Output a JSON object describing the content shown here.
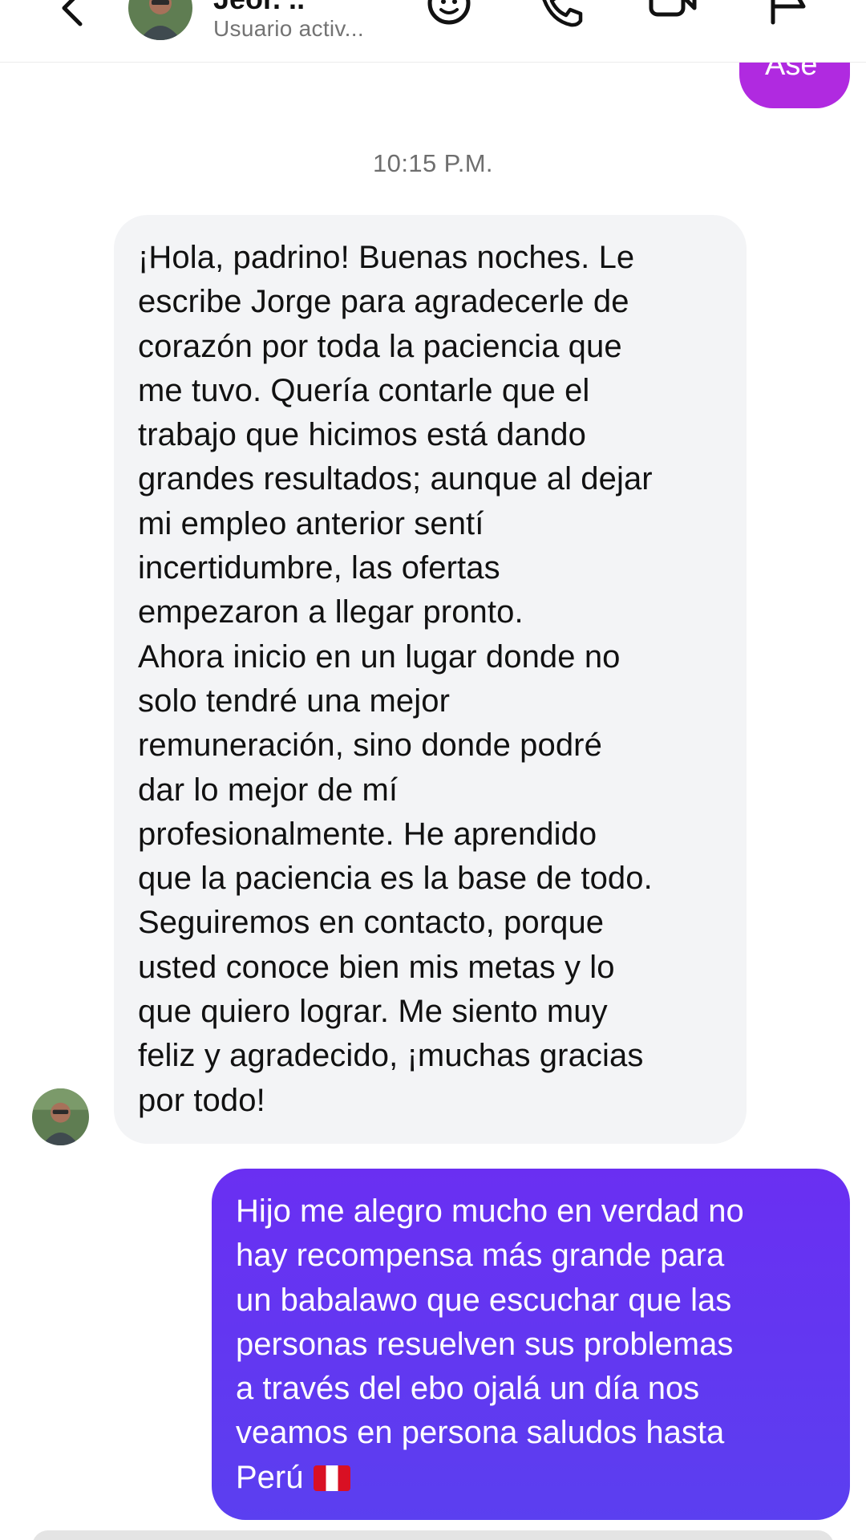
{
  "header": {
    "contact_name": "Jeor. ..",
    "contact_status": "Usuario activ...",
    "icons": [
      "back-arrow",
      "avatar",
      "sticker-face",
      "phone-call",
      "video-call",
      "flag-report"
    ]
  },
  "previous_message": {
    "text": "Ase"
  },
  "timestamp": "10:15 P.M.",
  "incoming_message": {
    "text": "¡Hola, padrino! Buenas noches. Le\nescribe Jorge para agradecerle de\ncorazón por toda la paciencia que\nme tuvo. Quería contarle que el\ntrabajo que hicimos está dando\ngrandes resultados; aunque al dejar\nmi empleo anterior sentí\nincertidumbre, las ofertas\nempezaron a llegar pronto.\nAhora inicio en un lugar donde no\nsolo tendré una mejor\nremuneración, sino donde podré\ndar lo mejor de mí\nprofesionalmente. He aprendido\nque la paciencia es la base de todo.\nSeguiremos en contacto, porque\nusted conoce bien mis metas y lo\nque quiero lograr. Me siento muy\nfeliz y agradecido, ¡muchas gracias\npor todo!"
  },
  "outgoing_message": {
    "text": "Hijo me alegro mucho en verdad  no\nhay recompensa más grande para\nun babalawo que escuchar que las\npersonas resuelven sus problemas\na través del ebo ojalá un día nos\nveamos en persona saludos hasta\nPerú",
    "emoji": "peru-flag"
  },
  "colors": {
    "incoming_bubble": "#f3f4f6",
    "outgoing_bubble": "#5f39f1",
    "previous_bubble": "#b02ae0",
    "timestamp": "#6e6e6e",
    "status": "#737373"
  }
}
